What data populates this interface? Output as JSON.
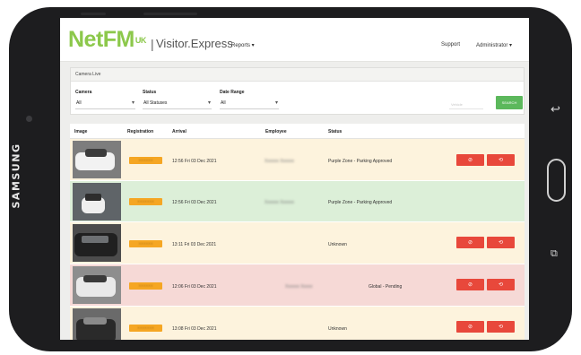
{
  "device": {
    "brand": "SAMSUNG",
    "back_icon": "back-arrow-icon",
    "recents_icon": "recents-icon"
  },
  "app": {
    "logo_main": "NetFM",
    "logo_sup": "UK",
    "separator": "|",
    "product": "Visitor.Express",
    "menu_reports": "Reports ▾",
    "menu_support": "Support",
    "menu_admin": "Administrator ▾"
  },
  "filters": {
    "panel_title": "Camera Live",
    "camera_label": "Camera",
    "camera_value": "All",
    "status_label": "Status",
    "status_value": "All Statuses",
    "date_label": "Date Range",
    "date_value": "All",
    "vehicle_placeholder": "Vehicle",
    "search_button": "SEARCH"
  },
  "table": {
    "headers": [
      "Image",
      "Registration",
      "Arrival",
      "Employee",
      "Status"
    ],
    "rows": [
      {
        "registration": "XXXXXX",
        "arrival": "12:56 Fri 03 Dec 2021",
        "employee": "Xxxxxx Xxxxxx",
        "status": "Purple Zone - Parking Approved",
        "bg": "#fdf3dd"
      },
      {
        "registration": "XXXXXXX",
        "arrival": "12:56 Fri 03 Dec 2021",
        "employee": "Xxxxxx Xxxxxx",
        "status": "Purple Zone - Parking Approved",
        "bg": "#dcefd8"
      },
      {
        "registration": "XXXXXX",
        "arrival": "13:11 Fri 03 Dec 2021",
        "employee": "",
        "status": "Unknown",
        "bg": "#fdf3dd"
      },
      {
        "registration": "XXXXXX",
        "arrival": "12:06 Fri 03 Dec 2021",
        "employee": "Xxxxxx Xxxxx",
        "status": "Global - Pending",
        "bg": "#f6d9d6"
      },
      {
        "registration": "XXXXXXX",
        "arrival": "13:08 Fri 03 Dec 2021",
        "employee": "",
        "status": "Unknown",
        "bg": "#fdf3dd"
      }
    ],
    "action_deny_icon": "cancel-circle-icon",
    "action_retry_icon": "refresh-icon",
    "action_deny_glyph": "⊘",
    "action_retry_glyph": "⟲"
  },
  "colors": {
    "brand_green": "#8cc84b",
    "plate_orange": "#f5a623",
    "action_red": "#e8483b",
    "search_green": "#5cb85c"
  }
}
